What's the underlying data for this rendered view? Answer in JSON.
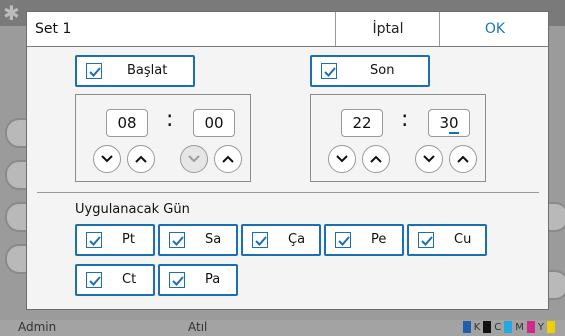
{
  "dialog": {
    "title": "Set 1",
    "cancel_label": "İptal",
    "ok_label": "OK"
  },
  "start": {
    "label": "Başlat",
    "checked": true,
    "hour": "08",
    "minute": "00"
  },
  "end": {
    "label": "Son",
    "checked": true,
    "hour": "22",
    "minute_first_digit": "3",
    "minute_caret_digit": "0"
  },
  "days": {
    "title": "Uygulanacak Gün",
    "items": [
      {
        "label": "Pt",
        "checked": true
      },
      {
        "label": "Sa",
        "checked": true
      },
      {
        "label": "Ça",
        "checked": true
      },
      {
        "label": "Pe",
        "checked": true
      },
      {
        "label": "Cu",
        "checked": true
      },
      {
        "label": "Ct",
        "checked": true
      },
      {
        "label": "Pa",
        "checked": true
      }
    ]
  },
  "background": {
    "user": "Admin",
    "status_mid": "Atıl"
  },
  "colors": {
    "accent": "#1c6fb5",
    "ok_text": "#1a74c4"
  }
}
